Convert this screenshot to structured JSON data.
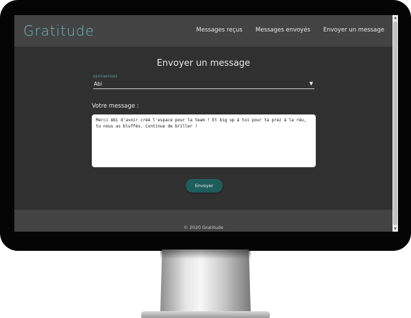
{
  "app": {
    "brand": "Gratitude"
  },
  "nav": {
    "items": [
      {
        "label": "Messages reçus"
      },
      {
        "label": "Messages envoyés"
      },
      {
        "label": "Envoyer un message"
      }
    ]
  },
  "form": {
    "title": "Envoyer un message",
    "recipient_label": "Destinataire",
    "recipient_value": "Abi",
    "message_label": "Votre message :",
    "message_value": "Merci Abi d'avoir créé l'espace pour la team ! Et big up à toi pour ta prez à la réu, tu nous as bluffés. Continue de briller !",
    "submit_label": "Envoyer"
  },
  "footer": {
    "copyright": "© 2020 Gratitude"
  },
  "colors": {
    "brand": "#73bdb3",
    "button": "#1f5d5c",
    "header_bg": "#434343",
    "content_bg": "#303030"
  },
  "icons": {
    "dropdown": "triangle-down-icon",
    "cursor": "mouse-pointer-icon"
  }
}
